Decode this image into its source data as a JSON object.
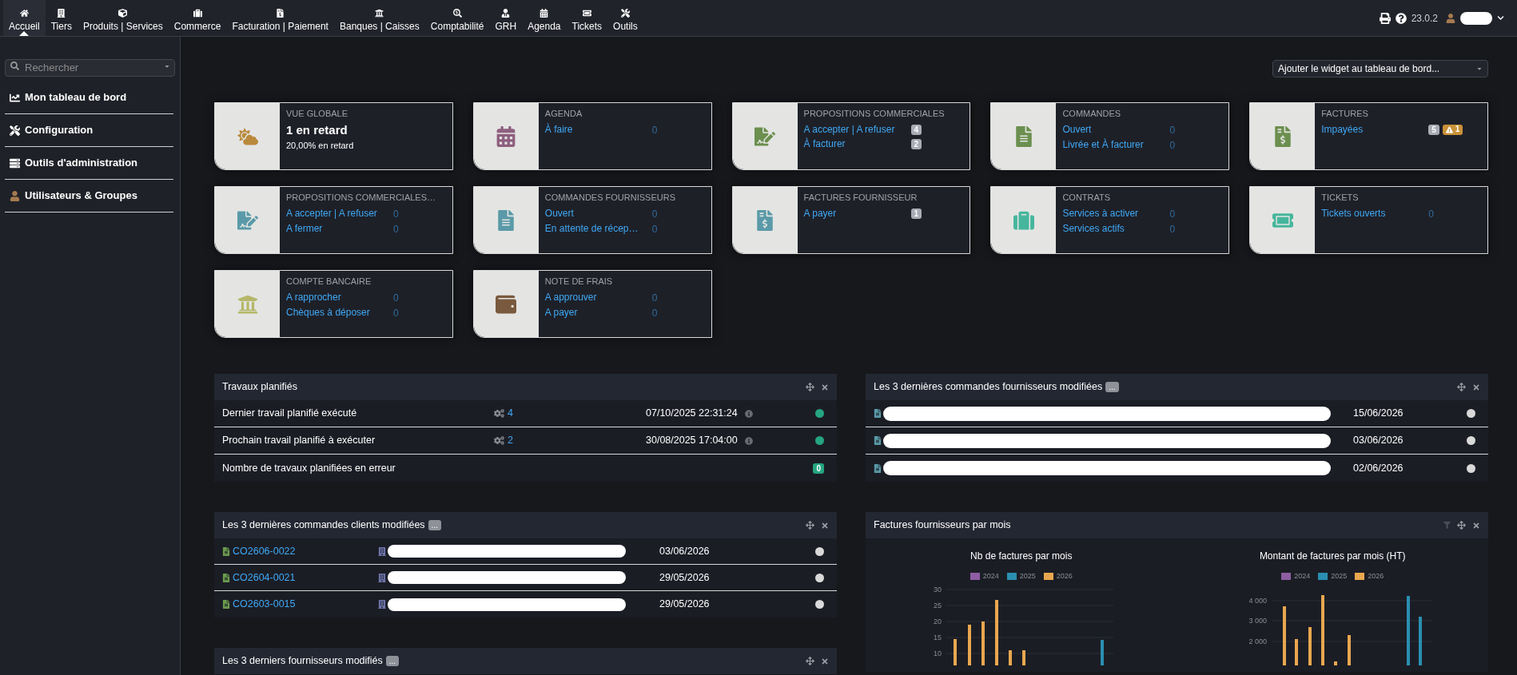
{
  "top_menu": {
    "items": [
      {
        "label": "Accueil",
        "selected": true
      },
      {
        "label": "Tiers",
        "selected": false
      },
      {
        "label": "Produits | Services",
        "selected": false
      },
      {
        "label": "Commerce",
        "selected": false
      },
      {
        "label": "Facturation | Paiement",
        "selected": false
      },
      {
        "label": "Banques | Caisses",
        "selected": false
      },
      {
        "label": "Comptabilité",
        "selected": false
      },
      {
        "label": "GRH",
        "selected": false
      },
      {
        "label": "Agenda",
        "selected": false
      },
      {
        "label": "Tickets",
        "selected": false
      },
      {
        "label": "Outils",
        "selected": false
      }
    ]
  },
  "top_right": {
    "version": "23.0.2"
  },
  "sidebar": {
    "search": {
      "placeholder": "Rechercher"
    },
    "items": [
      {
        "label": "Mon tableau de bord"
      },
      {
        "label": "Configuration"
      },
      {
        "label": "Outils d'administration"
      },
      {
        "label": "Utilisateurs & Groupes"
      }
    ]
  },
  "widget_picker": {
    "value": "Ajouter le widget au tableau de bord..."
  },
  "cards": [
    {
      "kind": "summary",
      "title": "VUE GLOBALE",
      "color": "#b98a3c",
      "headline": "1 en retard",
      "subline": "20,00% en retard"
    },
    {
      "kind": "links",
      "title": "AGENDA",
      "color": "#8e5f7f",
      "rows": [
        {
          "label": "À faire",
          "values": [
            {
              "kind": "plain",
              "text": "0"
            }
          ]
        }
      ]
    },
    {
      "kind": "links",
      "title": "PROPOSITIONS COMMERCIALES",
      "color": "#6b8f4e",
      "rows": [
        {
          "label": "A accepter | A refuser",
          "values": [
            {
              "kind": "badge",
              "text": "4"
            }
          ]
        },
        {
          "label": "À facturer",
          "values": [
            {
              "kind": "badge",
              "text": "2"
            }
          ]
        }
      ]
    },
    {
      "kind": "links",
      "title": "COMMANDES",
      "color": "#6b8f4e",
      "rows": [
        {
          "label": "Ouvert",
          "values": [
            {
              "kind": "plain",
              "text": "0"
            }
          ]
        },
        {
          "label": "Livrée et À facturer",
          "values": [
            {
              "kind": "plain",
              "text": "0"
            }
          ]
        }
      ]
    },
    {
      "kind": "links",
      "title": "FACTURES",
      "color": "#6b8f4e",
      "rows": [
        {
          "label": "Impayées",
          "values": [
            {
              "kind": "badge",
              "text": "5"
            },
            {
              "kind": "warning",
              "text": "1"
            }
          ]
        }
      ]
    },
    {
      "kind": "links",
      "title": "PROPOSITIONS COMMERCIALES…",
      "color": "#5a9aa8",
      "rows": [
        {
          "label": "A accepter | A refuser",
          "values": [
            {
              "kind": "plain",
              "text": "0"
            }
          ]
        },
        {
          "label": "A fermer",
          "values": [
            {
              "kind": "plain",
              "text": "0"
            }
          ]
        }
      ]
    },
    {
      "kind": "links",
      "title": "COMMANDES FOURNISSEURS",
      "color": "#5a9aa8",
      "rows": [
        {
          "label": "Ouvert",
          "values": [
            {
              "kind": "plain",
              "text": "0"
            }
          ]
        },
        {
          "label": "En attente de récep…",
          "values": [
            {
              "kind": "plain",
              "text": "0"
            }
          ]
        }
      ]
    },
    {
      "kind": "links",
      "title": "FACTURES FOURNISSEUR",
      "color": "#5a9aa8",
      "rows": [
        {
          "label": "A payer",
          "values": [
            {
              "kind": "badge",
              "text": "1"
            }
          ]
        }
      ]
    },
    {
      "kind": "links",
      "title": "CONTRATS",
      "color": "#45b69c",
      "rows": [
        {
          "label": "Services à activer",
          "values": [
            {
              "kind": "plain",
              "text": "0"
            }
          ]
        },
        {
          "label": "Services actifs",
          "values": [
            {
              "kind": "plain",
              "text": "0"
            }
          ]
        }
      ]
    },
    {
      "kind": "links",
      "title": "TICKETS",
      "color": "#45b69c",
      "rows": [
        {
          "label": "Tickets ouverts",
          "values": [
            {
              "kind": "plain",
              "text": "0"
            }
          ]
        }
      ]
    },
    {
      "kind": "links",
      "title": "COMPTE BANCAIRE",
      "color": "#b5b86a",
      "rows": [
        {
          "label": "A rapprocher",
          "values": [
            {
              "kind": "plain",
              "text": "0"
            }
          ]
        },
        {
          "label": "Chèques à déposer",
          "values": [
            {
              "kind": "plain",
              "text": "0"
            }
          ]
        }
      ]
    },
    {
      "kind": "links",
      "title": "NOTE DE FRAIS",
      "color": "#7a5a3e",
      "rows": [
        {
          "label": "A approuver",
          "values": [
            {
              "kind": "plain",
              "text": "0"
            }
          ]
        },
        {
          "label": "A payer",
          "values": [
            {
              "kind": "plain",
              "text": "0"
            }
          ]
        }
      ]
    }
  ],
  "widgets_left": [
    {
      "kind": "jobs",
      "title": "Travaux planifiés",
      "rows": [
        {
          "kind": "job",
          "label": "Dernier travail planifié exécuté",
          "count": "4",
          "datetime": "07/10/2025 22:31:24",
          "color": "#25a580"
        },
        {
          "kind": "job",
          "label": "Prochain travail planifié à exécuter",
          "count": "2",
          "datetime": "30/08/2025 17:04:00",
          "color": "#25a580"
        },
        {
          "kind": "count",
          "label": "Nombre de travaux planifiées en erreur",
          "badge": "0"
        }
      ]
    },
    {
      "kind": "customer_orders",
      "title": "Les 3 dernières commandes clients modifiées",
      "badge": "...",
      "rows": [
        {
          "ref": "CO2606-0022",
          "date": "03/06/2026",
          "color": "#d9d9d9"
        },
        {
          "ref": "CO2604-0021",
          "date": "29/05/2026",
          "color": "#d9d9d9"
        },
        {
          "ref": "CO2603-0015",
          "date": "29/05/2026",
          "color": "#d9d9d9"
        }
      ]
    },
    {
      "kind": "list",
      "title": "Les 3 derniers fournisseurs modifiés",
      "badge": "..."
    }
  ],
  "widgets_right": [
    {
      "kind": "supplier_orders",
      "title": "Les 3 dernières commandes fournisseurs modifiées",
      "badge": "...",
      "rows": [
        {
          "date": "15/06/2026",
          "color": "#d9d9d9"
        },
        {
          "date": "03/06/2026",
          "color": "#d9d9d9"
        },
        {
          "date": "02/06/2026",
          "color": "#d9d9d9"
        }
      ]
    },
    {
      "kind": "charts",
      "title": "Factures fournisseurs par mois",
      "charts": [
        {
          "title": "Nb de factures par mois",
          "legend": [
            {
              "label": "2024",
              "color": "#8e5ea2"
            },
            {
              "label": "2025",
              "color": "#2a8fb0"
            },
            {
              "label": "2026",
              "color": "#e8a74f"
            }
          ],
          "yticks": [
            "30",
            "25",
            "20",
            "15",
            "10"
          ]
        },
        {
          "title": "Montant de factures par mois (HT)",
          "legend": [
            {
              "label": "2024",
              "color": "#8e5ea2"
            },
            {
              "label": "2025",
              "color": "#2a8fb0"
            },
            {
              "label": "2026",
              "color": "#e8a74f"
            }
          ],
          "yticks": [
            "4 000",
            "3 000",
            "2 000"
          ]
        }
      ]
    }
  ]
}
